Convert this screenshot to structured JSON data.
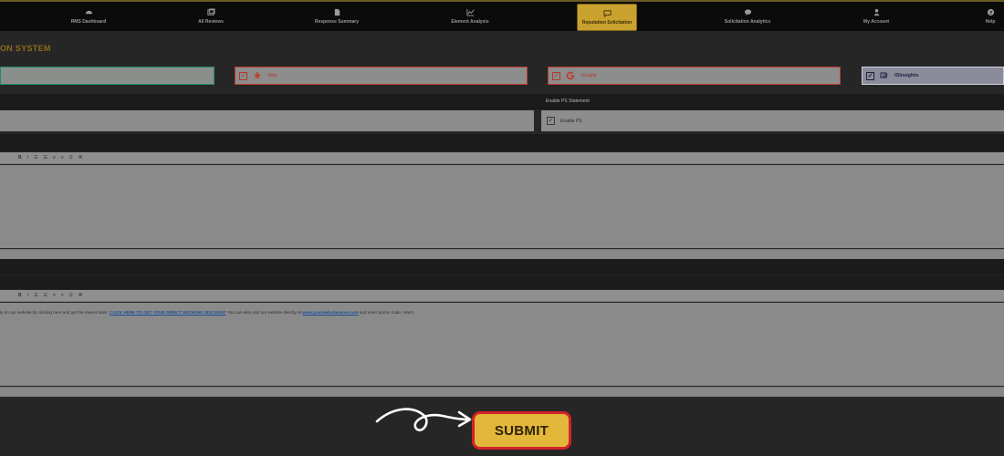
{
  "nav": {
    "items": [
      {
        "label": "RMS Dashboard",
        "icon": "gauge-icon"
      },
      {
        "label": "All Reviews",
        "icon": "reviews-icon"
      },
      {
        "label": "Response Summary",
        "icon": "document-icon"
      },
      {
        "label": "Element Analysis",
        "icon": "chart-icon"
      },
      {
        "label": "Reputation Solicitation",
        "icon": "chat-icon",
        "active": true
      },
      {
        "label": "Solicitation Analytics",
        "icon": "speech-icon"
      },
      {
        "label": "My Account",
        "icon": "user-icon"
      },
      {
        "label": "Help",
        "icon": "help-icon"
      }
    ]
  },
  "page": {
    "title": "ON SYSTEM"
  },
  "platforms": [
    {
      "label": "",
      "checked": false
    },
    {
      "label": "Yelp",
      "checked": true,
      "icon": "yelp-icon"
    },
    {
      "label": "Google",
      "checked": true,
      "icon": "google-icon"
    },
    {
      "label": "ISInsights",
      "checked": true,
      "icon": "insights-icon"
    }
  ],
  "ps": {
    "section_label": "Enable PS Statement",
    "checkbox_label": "Enable PS",
    "checked": true
  },
  "editor1": {
    "toolbar": [
      "B",
      "I",
      "☰",
      "☰",
      "≡",
      "≡",
      "Ω",
      "⌘"
    ],
    "status": ""
  },
  "editor2": {
    "toolbar": [
      "B",
      "I",
      "☰",
      "☰",
      "≡",
      "≡",
      "Ω",
      "⌘"
    ],
    "text_before": "ly on our website by clicking here and get the lowest rates:",
    "link1": "CLICK HERE TO GET YOUR DIRECT BOOKING DISCOUNT",
    "text_middle": "You can also visit our website directly at",
    "link2": "www.yourwebsitename.com",
    "text_after": "and enter promo code: return"
  },
  "submit": {
    "label": "SUBMIT"
  },
  "colors": {
    "accent": "#c9a12e",
    "submit_bg": "#e2b73a",
    "submit_border": "#d3222a"
  }
}
